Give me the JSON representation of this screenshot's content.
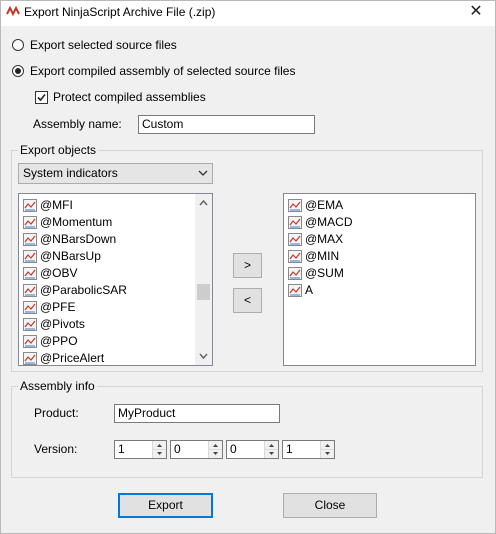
{
  "window": {
    "title": "Export NinjaScript Archive File (.zip)",
    "close_glyph": "✕",
    "icon": "ninjatrader-logo-icon"
  },
  "export_mode": {
    "option_source": "Export selected source files",
    "option_compiled": "Export compiled assembly of selected source files",
    "selected": "compiled"
  },
  "protect": {
    "label": "Protect compiled assemblies",
    "checked": true
  },
  "assembly_name": {
    "label": "Assembly name:",
    "value": "Custom"
  },
  "export_objects": {
    "group_title": "Export objects",
    "type_selected": "System indicators",
    "available": [
      "@MFI",
      "@Momentum",
      "@NBarsDown",
      "@NBarsUp",
      "@OBV",
      "@ParabolicSAR",
      "@PFE",
      "@Pivots",
      "@PPO",
      "@PriceAlert"
    ],
    "selected_items": [
      "@EMA",
      "@MACD",
      "@MAX",
      "@MIN",
      "@SUM",
      "A"
    ],
    "add_button": ">",
    "remove_button": "<",
    "scroll_position": 0.6
  },
  "assembly_info": {
    "group_title": "Assembly info",
    "product_label": "Product:",
    "product_value": "MyProduct",
    "version_label": "Version:",
    "version": [
      "1",
      "0",
      "0",
      "1"
    ]
  },
  "actions": {
    "export": "Export",
    "close": "Close"
  }
}
